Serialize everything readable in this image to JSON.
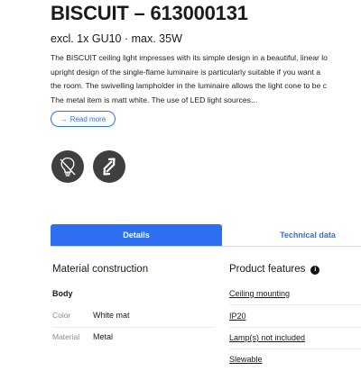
{
  "product": {
    "title": "BISCUIT – 613000131",
    "subtitle": "excl. 1x GU10 · max. 35W",
    "description_lines": [
      "The BISCUIT ceiling light impresses with its simple design in a beautiful, linear lo",
      "upright design of the single-flame luminaire is particularly suitable if you want a",
      "the room. The swivelling lampholder in the luminaire allows the light cone to be c",
      "The metal item is matt white. The use of LED light sources..."
    ],
    "read_more_label": "Read more"
  },
  "icons": [
    {
      "name": "bulb-not-included-icon"
    },
    {
      "name": "swivel-arrows-icon"
    }
  ],
  "tabs": {
    "details": "Details",
    "technical": "Technical data"
  },
  "material": {
    "heading": "Material construction",
    "group": "Body",
    "rows": [
      {
        "label": "Color",
        "value": "White mat"
      },
      {
        "label": "Material",
        "value": "Metal"
      }
    ]
  },
  "features": {
    "heading": "Product features",
    "items": [
      "Ceiling mounting",
      "IP20",
      "Lamp(s) not included",
      "Slewable"
    ]
  },
  "colors": {
    "accent": "#2d6ff0",
    "icon_bg": "#3f3f3f"
  }
}
